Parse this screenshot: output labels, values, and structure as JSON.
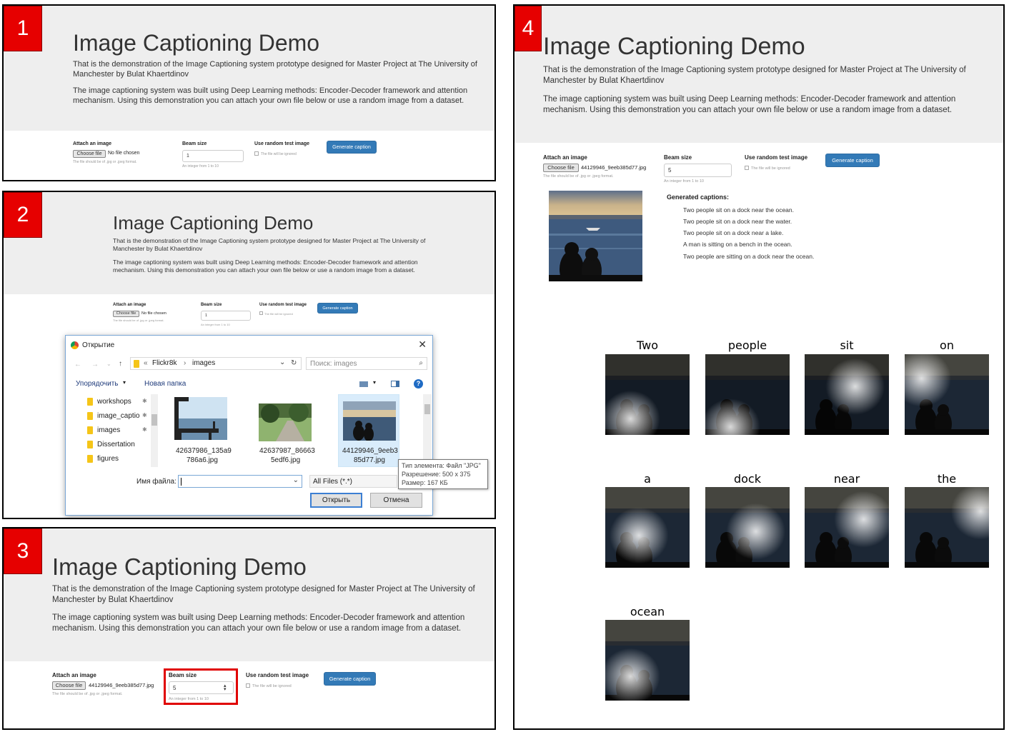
{
  "app": {
    "title": "Image Captioning Demo",
    "intro": "That is the demonstration of the Image Captioning system prototype designed for Master Project at The University of Manchester by Bulat Khaertdinov",
    "desc": "The image captioning system was built using Deep Learning methods: Encoder-Decoder framework and attention mechanism. Using this demonstration you can attach your own file below or use a random image from a dataset."
  },
  "form": {
    "attach_label": "Attach an image",
    "choose_file": "Choose file",
    "no_file": "No file chosen",
    "file_help": "The file should be of .jpg or .jpeg format.",
    "beam_label": "Beam size",
    "beam_help": "An integer from 1 to 10",
    "random_label": "Use random test image",
    "random_help": "The file will be ignored",
    "generate": "Generate caption",
    "chosen_file": "44129946_9eeb385d77.jpg"
  },
  "steps": [
    "1",
    "2",
    "3",
    "4"
  ],
  "panels": {
    "p1_beam": "1",
    "p2_beam": "1",
    "p3_beam": "5",
    "p4_beam": "5"
  },
  "dialog": {
    "title": "Открытие",
    "path1": "Flickr8k",
    "path2": "images",
    "search": "Поиск: images",
    "organize": "Упорядочить",
    "new_folder": "Новая папка",
    "folders": [
      "workshops",
      "image_captio",
      "images",
      "Dissertation",
      "figures"
    ],
    "files": [
      {
        "name1": "42637986_135a9",
        "name2": "786a6.jpg"
      },
      {
        "name1": "42637987_86663",
        "name2": "5edf6.jpg"
      },
      {
        "name1": "44129946_9eeb3",
        "name2": "85d77.jpg"
      }
    ],
    "tooltip": [
      "Тип элемента: Файл \"JPG\"",
      "Разрешение: 500 x 375",
      "Размер: 167 КБ"
    ],
    "filename_label": "Имя файла:",
    "filter": "All Files (*.*)",
    "open": "Открыть",
    "cancel": "Отмена"
  },
  "result": {
    "captions_title": "Generated captions:",
    "captions": [
      "Two people sit on a dock near the ocean.",
      "Two people sit on a dock near the water.",
      "Two people sit on a dock near a lake.",
      "A man is sitting on a bench in the ocean.",
      "Two people are sitting on a dock near the ocean."
    ],
    "words": [
      "Two",
      "people",
      "sit",
      "on",
      "a",
      "dock",
      "near",
      "the",
      "ocean"
    ]
  },
  "colors": {
    "badge": "#e60000",
    "jumbotron": "#eeeeee",
    "primary": "#337ab7",
    "highlight": "#e00000"
  }
}
